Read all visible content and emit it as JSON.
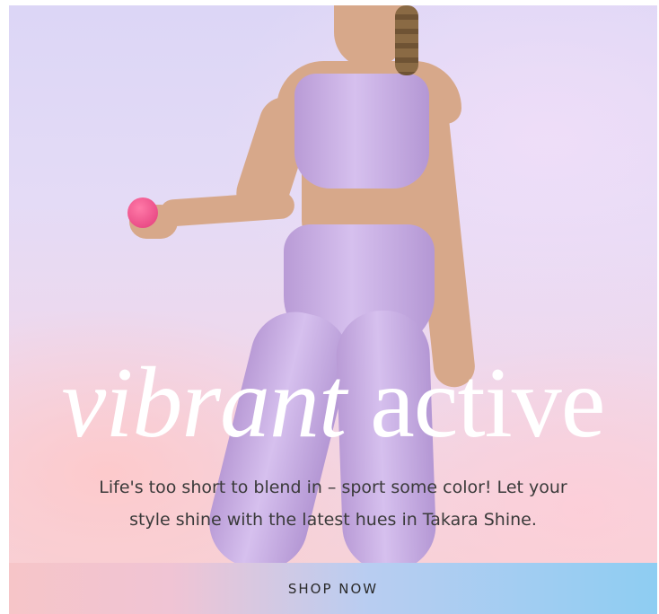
{
  "promo": {
    "headline_italic": "vibrant",
    "headline_regular": "active",
    "body_line1": "Life's too short to blend in – sport some color! Let your",
    "body_line2": "style shine with the latest hues in Takara Shine.",
    "cta_label": "SHOP NOW"
  },
  "colors": {
    "outfit": "#c6aee6",
    "cta_left": "#f6c5c8",
    "cta_right": "#8ecdf2",
    "headline": "#ffffff",
    "body_text": "#3a3a3a"
  }
}
